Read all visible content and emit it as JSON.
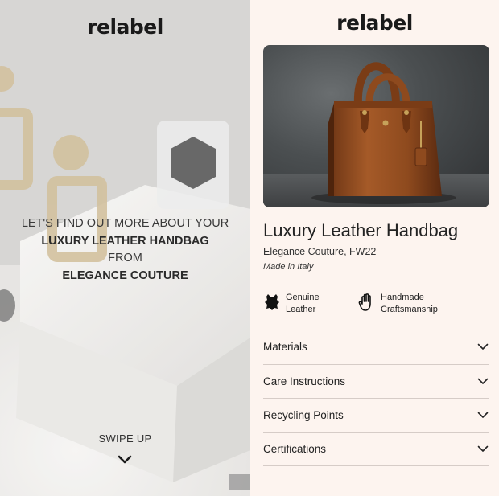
{
  "brand": {
    "logo_text": "relabel"
  },
  "intro": {
    "line1": "LET'S FIND OUT MORE ABOUT YOUR",
    "product_name": "LUXURY LEATHER HANDBAG",
    "line3": "FROM",
    "brand_name": "ELEGANCE COUTURE"
  },
  "swipe": {
    "label": "SWIPE UP",
    "icon": "chevron-down-icon"
  },
  "product": {
    "title": "Luxury Leather Handbag",
    "brand_line": "Elegance Couture, FW22",
    "origin": "Made in Italy"
  },
  "features": [
    {
      "icon": "leather-hide-icon",
      "line1": "Genuine",
      "line2": "Leather"
    },
    {
      "icon": "hand-icon",
      "line1": "Handmade",
      "line2": "Craftsmanship"
    }
  ],
  "accordion": [
    {
      "label": "Materials",
      "icon": "chevron-down-icon"
    },
    {
      "label": "Care Instructions",
      "icon": "chevron-down-icon"
    },
    {
      "label": "Recycling Points",
      "icon": "chevron-down-icon"
    },
    {
      "label": "Certifications",
      "icon": "chevron-down-icon"
    }
  ],
  "colors": {
    "background": "#fdf4ef",
    "text": "#222222",
    "divider": "#d6ccc7",
    "leather": "#8b4a20"
  }
}
